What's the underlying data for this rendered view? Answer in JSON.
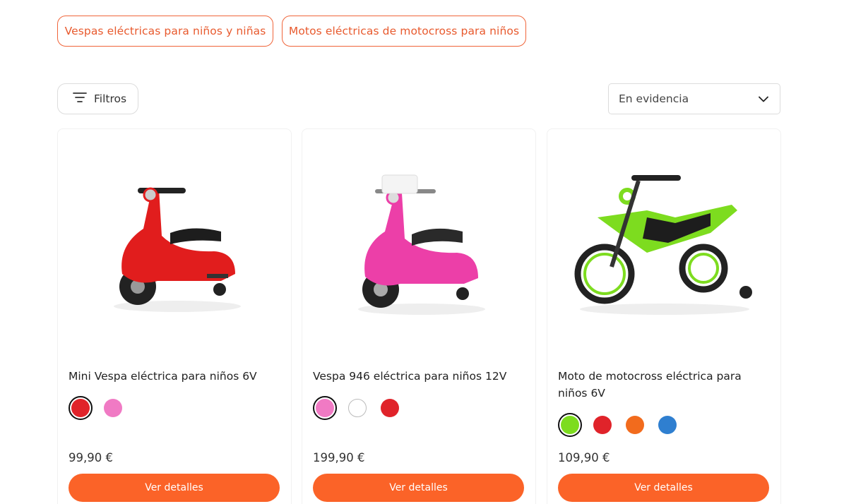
{
  "categories": [
    {
      "label": "Vespas eléctricas para niños y niñas"
    },
    {
      "label": "Motos eléctricas de motocross para niños"
    }
  ],
  "toolbar": {
    "filters_label": "Filtros",
    "sort_value": "En evidencia"
  },
  "theme": {
    "accent": "#fb6328",
    "chip_border": "#f0653a"
  },
  "products": [
    {
      "title": "Mini Vespa eléctrica para niños 6V",
      "price": "99,90 €",
      "button_label": "Ver detalles",
      "image_icon": "red-scooter-image",
      "colors": [
        "#e0232a",
        "#f07ac4"
      ],
      "selected_color_index": 0
    },
    {
      "title": "Vespa 946 eléctrica para niños 12V",
      "price": "199,90 €",
      "button_label": "Ver detalles",
      "image_icon": "pink-scooter-image",
      "colors": [
        "#f07ac4",
        "#ffffff",
        "#e0232a"
      ],
      "selected_color_index": 0
    },
    {
      "title": "Moto de motocross eléctrica para niños 6V",
      "price": "109,90 €",
      "button_label": "Ver detalles",
      "image_icon": "green-motocross-bike-image",
      "colors": [
        "#7ddc1f",
        "#e0232a",
        "#f26b1d",
        "#2f7fd0"
      ],
      "selected_color_index": 0
    }
  ]
}
